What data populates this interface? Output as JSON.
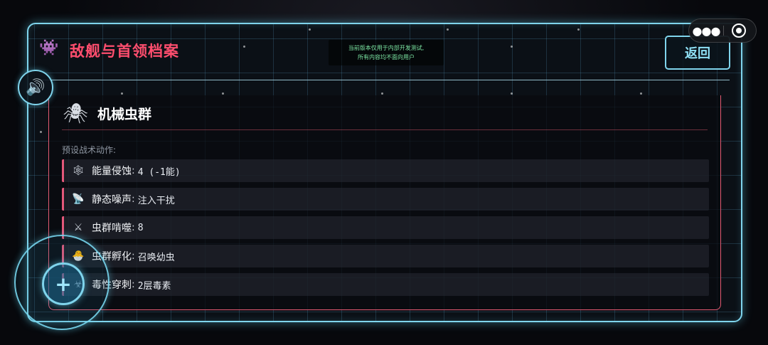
{
  "header": {
    "title": "敌舰与首领档案",
    "title_icon": "space-invader-icon",
    "back_label": "返回"
  },
  "notice": {
    "line1": "当前版本仅用于内部开发测试,",
    "line2": "所有内容均不面向用户"
  },
  "enemy": {
    "icon": "spider-icon",
    "name": "机械虫群",
    "section_label": "预设战术动作:",
    "moves": [
      {
        "icon": "spider-web-icon",
        "glyph": "🕸",
        "name": "能量侵蚀",
        "sep": ":",
        "value": "4 (-1能)"
      },
      {
        "icon": "satellite-dish-icon",
        "glyph": "📡",
        "name": "静态噪声",
        "sep": ":",
        "value": "注入干扰"
      },
      {
        "icon": "crossed-swords-icon",
        "glyph": "⚔",
        "name": "虫群啃噬",
        "sep": ":",
        "value": "8"
      },
      {
        "icon": "hatching-chick-icon",
        "glyph": "🐣",
        "name": "虫群孵化",
        "sep": ":",
        "value": "召唤幼虫"
      },
      {
        "icon": "biohazard-icon",
        "glyph": "☣",
        "name": "毒性穿刺",
        "sep": ":",
        "value": "2层毒素"
      }
    ]
  },
  "controls": {
    "sound_icon": "speaker-icon",
    "joystick_icon": "plus-icon",
    "capsule_more_icon": "more-dots-icon",
    "capsule_close_icon": "target-circle-icon"
  },
  "colors": {
    "accent_cyan": "#7fd4ec",
    "title_red": "#ff4e6e",
    "card_border": "#e45a72",
    "notice_green": "#7de7a4"
  }
}
